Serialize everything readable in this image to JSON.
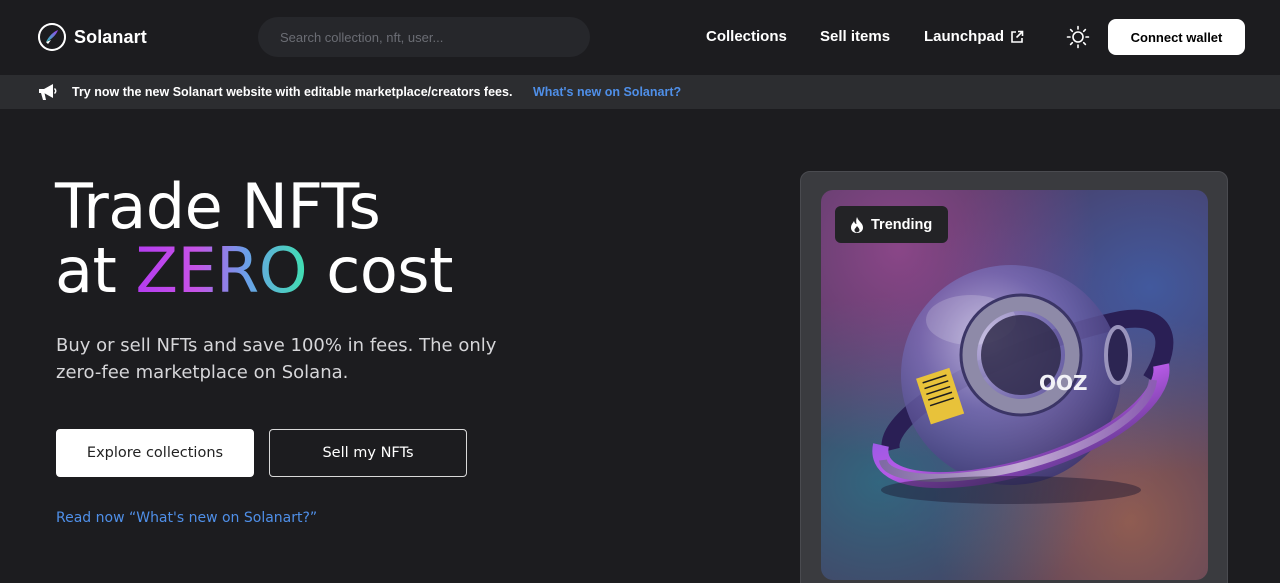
{
  "header": {
    "brand": "Solanart",
    "search": {
      "placeholder": "Search collection, nft, user...",
      "value": ""
    },
    "nav": {
      "collections": "Collections",
      "sell_items": "Sell items",
      "launchpad": "Launchpad"
    },
    "connect_wallet": "Connect wallet"
  },
  "banner": {
    "text": "Try now the new Solanart website with editable marketplace/creators fees.",
    "link": "What's new on Solanart?"
  },
  "hero": {
    "title_line1": "Trade NFTs",
    "title_at": "at",
    "title_zero": "ZERO",
    "title_cost": "cost",
    "description": "Buy or sell NFTs and save 100% in fees. The only zero-fee marketplace on Solana.",
    "explore_button": "Explore collections",
    "sell_button": "Sell my NFTs",
    "read_link": "Read now “What's new on Solanart?”"
  },
  "trending": {
    "badge": "Trending",
    "nft_label": "OOZ"
  },
  "colors": {
    "background": "#1c1c1f",
    "banner": "#2c2d30",
    "link": "#4f8fe8",
    "zero_gradient_start": "#b43bf0",
    "zero_gradient_end": "#3fe0b0"
  }
}
